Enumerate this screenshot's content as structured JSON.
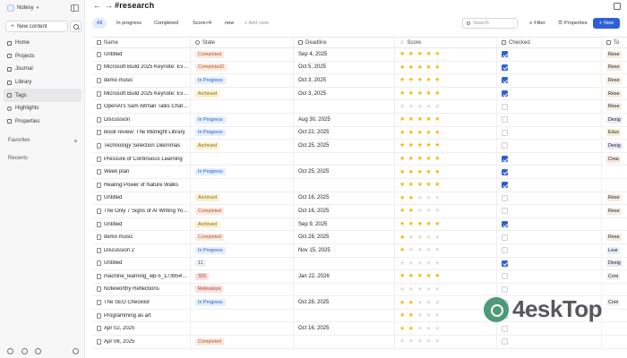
{
  "workspace": {
    "name": "Notesy"
  },
  "sidebar": {
    "new_content": "New content",
    "items": [
      {
        "label": "Home",
        "active": false
      },
      {
        "label": "Projects",
        "active": false
      },
      {
        "label": "Journal",
        "active": false
      },
      {
        "label": "Library",
        "active": false
      },
      {
        "label": "Tags",
        "active": true
      },
      {
        "label": "Highlights",
        "active": false
      },
      {
        "label": "Properties",
        "active": false
      }
    ],
    "favorites": "Favorites",
    "recents": "Recents"
  },
  "header": {
    "title": "#research"
  },
  "toolbar": {
    "tabs": [
      "All",
      "In progress",
      "Completed",
      "Score>4",
      "new"
    ],
    "add_view": "+ Add view",
    "search_placeholder": "Search",
    "filter": "Filter",
    "properties": "Properties",
    "new": "New"
  },
  "table": {
    "columns": [
      "Name",
      "State",
      "Deadline",
      "Score",
      "Checked",
      "To"
    ],
    "rows": [
      {
        "name": "Untitled",
        "state": "Completed",
        "deadline": "Sep 4, 2025",
        "score": 5,
        "checked": true,
        "tag": "Rese"
      },
      {
        "name": "Microsoft Build 2025 Keynote: Everyt...",
        "state": "Completed2",
        "deadline": "Oct 5, 2025",
        "score": 5,
        "checked": true,
        "tag": "Rese"
      },
      {
        "name": "demo music",
        "state": "In Progress",
        "deadline": "Oct 3, 2025",
        "score": 5,
        "checked": true,
        "tag": "Rese"
      },
      {
        "name": "Microsoft Build 2025 Keynote: Everyt...",
        "state": "Archived",
        "deadline": "Oct 3, 2025",
        "score": 5,
        "checked": true,
        "tag": "Rese"
      },
      {
        "name": "OpenAI's Sam Altman Talks ChatGP...",
        "state": "",
        "deadline": "",
        "score": 0,
        "checked": false,
        "tag": "Rese"
      },
      {
        "name": "Discussion",
        "state": "In Progress",
        "deadline": "Aug 30, 2025",
        "score": 5,
        "checked": false,
        "tag": "Desig"
      },
      {
        "name": "Book review: The Midnight Library",
        "state": "In Progress",
        "deadline": "Oct 22, 2025",
        "score": 5,
        "checked": false,
        "tag": "Educ"
      },
      {
        "name": "Technology Selection Dilemmas",
        "state": "Archived",
        "deadline": "Oct 25, 2025",
        "score": 5,
        "checked": false,
        "tag": "Desig"
      },
      {
        "name": "Pressure of Continuous Learning",
        "state": "",
        "deadline": "",
        "score": 5,
        "checked": true,
        "tag": "Crea"
      },
      {
        "name": "Week plan",
        "state": "In Progress",
        "deadline": "Oct 25, 2025",
        "score": 5,
        "checked": true,
        "tag": ""
      },
      {
        "name": "Healing Power of Nature Walks",
        "state": "",
        "deadline": "",
        "score": 5,
        "checked": true,
        "tag": ""
      },
      {
        "name": "Untitled",
        "state": "Archived",
        "deadline": "Oct 16, 2025",
        "score": 2,
        "checked": false,
        "tag": "Rese"
      },
      {
        "name": "The Only 7 Signs of AI Writing You N...",
        "state": "Completed",
        "deadline": "Oct 16, 2025",
        "score": 2,
        "checked": false,
        "tag": "Rese"
      },
      {
        "name": "Untitled",
        "state": "Archived",
        "deadline": "Sep 9, 2025",
        "score": 5,
        "checked": true,
        "tag": ""
      },
      {
        "name": "demo music",
        "state": "Completed",
        "deadline": "Oct 28, 2025",
        "score": 1,
        "checked": false,
        "tag": "Rese"
      },
      {
        "name": "Discussion 2",
        "state": "In Progress",
        "deadline": "Nov 15, 2025",
        "score": 1,
        "checked": false,
        "tag": "Lear"
      },
      {
        "name": "Untitled",
        "state": "11",
        "deadline": "",
        "score": 0,
        "checked": true,
        "tag": "Desig"
      },
      {
        "name": "machine_learning_wp-5_17395437...",
        "state": "333",
        "deadline": "Jan 22, 2026",
        "score": 5,
        "checked": false,
        "tag": "Com"
      },
      {
        "name": "Noteworthy Reflections",
        "state": "Relevance",
        "deadline": "",
        "score": 0,
        "checked": false,
        "tag": ""
      },
      {
        "name": "The SEO Checklist",
        "state": "In Progress",
        "deadline": "Oct 28, 2025",
        "score": 2,
        "checked": false,
        "tag": "Com"
      },
      {
        "name": "Programming as art",
        "state": "",
        "deadline": "",
        "score": 2,
        "checked": false,
        "tag": ""
      },
      {
        "name": "Apr 02, 2025",
        "state": "",
        "deadline": "Oct 16, 2025",
        "score": 2,
        "checked": false,
        "tag": ""
      },
      {
        "name": "Apr 06, 2025",
        "state": "Completed",
        "deadline": "",
        "score": 0,
        "checked": false,
        "tag": ""
      }
    ]
  },
  "state_colors": {
    "Completed": [
      "#fde9df",
      "#b2552e"
    ],
    "Completed2": [
      "#fde9df",
      "#b2552e"
    ],
    "In Progress": [
      "#e3efff",
      "#2b5db5"
    ],
    "Archived": [
      "#fbf1cf",
      "#8a6a14"
    ],
    "11": [
      "#eceff3",
      "#555555"
    ],
    "333": [
      "#fbe0dd",
      "#b23a2e"
    ],
    "Relevance": [
      "#fbe0dd",
      "#b23a2e"
    ]
  },
  "watermark": "4eskTop"
}
